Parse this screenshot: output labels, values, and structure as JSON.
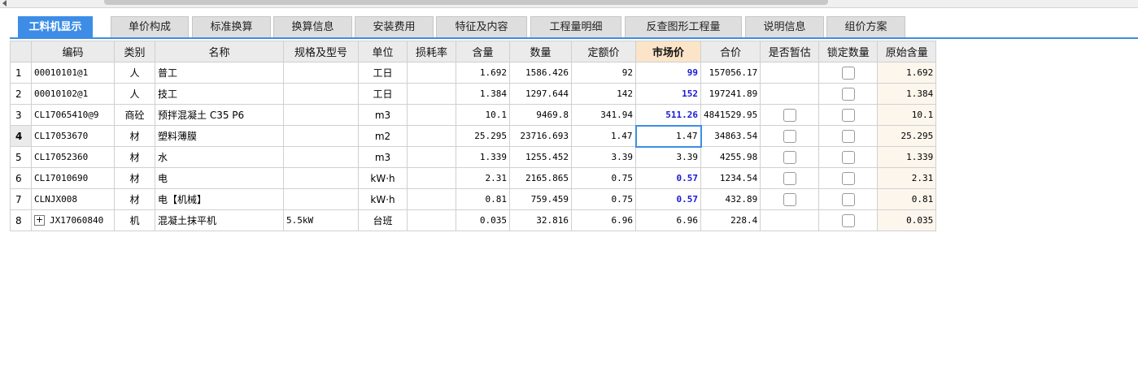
{
  "tabs": [
    "工料机显示",
    "单价构成",
    "标准换算",
    "换算信息",
    "安装费用",
    "特征及内容",
    "工程量明细",
    "反查图形工程量",
    "说明信息",
    "组价方案"
  ],
  "active_tab": 0,
  "columns": [
    "编码",
    "类别",
    "名称",
    "规格及型号",
    "单位",
    "损耗率",
    "含量",
    "数量",
    "定额价",
    "市场价",
    "合价",
    "是否暂估",
    "锁定数量",
    "原始含量"
  ],
  "highlighted_column": "市场价",
  "rows": [
    {
      "num": "1",
      "code": "00010101@1",
      "type": "人",
      "name": "普工",
      "spec": "",
      "unit": "工日",
      "loss": "",
      "content": "1.692",
      "qty": "1586.426",
      "quota": "92",
      "market": "99",
      "total": "157056.17",
      "estimate": false,
      "lock": true,
      "orig": "1.692"
    },
    {
      "num": "2",
      "code": "00010102@1",
      "type": "人",
      "name": "技工",
      "spec": "",
      "unit": "工日",
      "loss": "",
      "content": "1.384",
      "qty": "1297.644",
      "quota": "142",
      "market": "152",
      "total": "197241.89",
      "estimate": false,
      "lock": true,
      "orig": "1.384"
    },
    {
      "num": "3",
      "code": "CL17065410@9",
      "type": "商砼",
      "name": "预拌混凝土 C35 P6",
      "spec": "",
      "unit": "m3",
      "loss": "",
      "content": "10.1",
      "qty": "9469.8",
      "quota": "341.94",
      "market": "511.26",
      "total": "4841529.95",
      "estimate": true,
      "lock": true,
      "orig": "10.1"
    },
    {
      "num": "4",
      "code": "CL17053670",
      "type": "材",
      "name": "塑料薄膜",
      "spec": "",
      "unit": "m2",
      "loss": "",
      "content": "25.295",
      "qty": "23716.693",
      "quota": "1.47",
      "market": "1.47",
      "total": "34863.54",
      "estimate": true,
      "lock": true,
      "orig": "25.295"
    },
    {
      "num": "5",
      "code": "CL17052360",
      "type": "材",
      "name": "水",
      "spec": "",
      "unit": "m3",
      "loss": "",
      "content": "1.339",
      "qty": "1255.452",
      "quota": "3.39",
      "market": "3.39",
      "total": "4255.98",
      "estimate": true,
      "lock": true,
      "orig": "1.339"
    },
    {
      "num": "6",
      "code": "CL17010690",
      "type": "材",
      "name": "电",
      "spec": "",
      "unit": "kW·h",
      "loss": "",
      "content": "2.31",
      "qty": "2165.865",
      "quota": "0.75",
      "market": "0.57",
      "total": "1234.54",
      "estimate": true,
      "lock": true,
      "orig": "2.31"
    },
    {
      "num": "7",
      "code": "CLNJX008",
      "type": "材",
      "name": "电【机械】",
      "spec": "",
      "unit": "kW·h",
      "loss": "",
      "content": "0.81",
      "qty": "759.459",
      "quota": "0.75",
      "market": "0.57",
      "total": "432.89",
      "estimate": true,
      "lock": true,
      "orig": "0.81"
    },
    {
      "num": "8",
      "code": "JX17060840",
      "type": "机",
      "name": "混凝土抹平机",
      "spec": "5.5kW",
      "unit": "台班",
      "loss": "",
      "content": "0.035",
      "qty": "32.816",
      "quota": "6.96",
      "market": "6.96",
      "total": "228.4",
      "estimate": false,
      "lock": true,
      "orig": "0.035"
    }
  ],
  "selected_row": "4",
  "expand_symbol": "+",
  "colors": {
    "accent": "#3d8de6",
    "market_changed": "#1a1ad6",
    "highlight_header": "#fbe4c8"
  }
}
